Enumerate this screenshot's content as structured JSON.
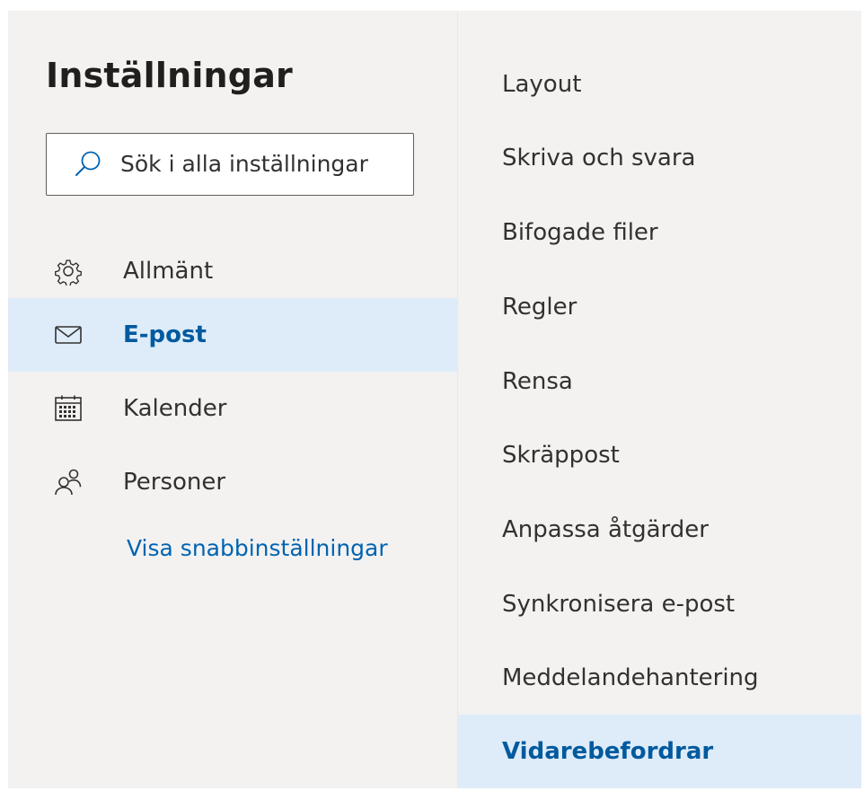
{
  "settings": {
    "title": "Inställningar",
    "search": {
      "placeholder": "Sök i alla inställningar",
      "value": ""
    },
    "nav": [
      {
        "label": "Allmänt",
        "icon": "gear-icon",
        "active": false
      },
      {
        "label": "E-post",
        "icon": "mail-icon",
        "active": true
      },
      {
        "label": "Kalender",
        "icon": "calendar-icon",
        "active": false
      },
      {
        "label": "Personer",
        "icon": "people-icon",
        "active": false
      }
    ],
    "quick_settings_link": "Visa snabbinställningar",
    "subnav": [
      {
        "label": "Layout",
        "active": false
      },
      {
        "label": "Skriva och svara",
        "active": false
      },
      {
        "label": "Bifogade filer",
        "active": false
      },
      {
        "label": "Regler",
        "active": false
      },
      {
        "label": "Rensa",
        "active": false
      },
      {
        "label": "Skräppost",
        "active": false
      },
      {
        "label": "Anpassa åtgärder",
        "active": false
      },
      {
        "label": "Synkronisera e-post",
        "active": false
      },
      {
        "label": "Meddelandehantering",
        "active": false
      },
      {
        "label": "Vidarebefordrar",
        "active": true
      }
    ]
  },
  "colors": {
    "background": "#f3f2f1",
    "selected_background": "#deecf9",
    "selected_text": "#005a9e",
    "link": "#0063b1",
    "text": "#323130"
  }
}
